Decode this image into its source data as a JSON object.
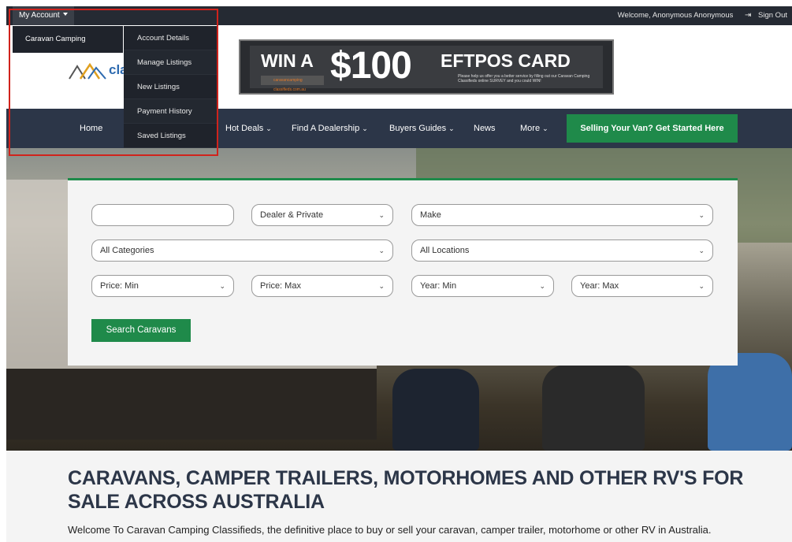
{
  "topbar": {
    "my_account_label": "My Account",
    "welcome_text": "Welcome, Anonymous Anonymous",
    "sign_out_label": "Sign Out"
  },
  "dropdown": {
    "site_label": "Caravan Camping Classifieds",
    "items": [
      {
        "label": "Account Details"
      },
      {
        "label": "Manage Listings"
      },
      {
        "label": "New Listings"
      },
      {
        "label": "Payment History"
      },
      {
        "label": "Saved Listings"
      }
    ]
  },
  "logo": {
    "partial_text": "cla"
  },
  "banner": {
    "win": "WIN A",
    "amount": "$100",
    "card": "EFTPOS CARD",
    "small": "Please help us offer you a better service by filling out our Caravan Camping Classifieds online SURVEY and you could WIN!",
    "brand": "caravancamping classifieds.com.au"
  },
  "nav": {
    "home": "Home",
    "hot_deals": "Hot Deals",
    "find_dealership": "Find A Dealership",
    "buyers_guides": "Buyers Guides",
    "news": "News",
    "more": "More",
    "cta": "Selling Your Van? Get Started Here"
  },
  "search": {
    "keyword_value": "",
    "seller_type": "Dealer & Private",
    "make": "Make",
    "categories": "All Categories",
    "locations": "All Locations",
    "price_min": "Price: Min",
    "price_max": "Price: Max",
    "year_min": "Year: Min",
    "year_max": "Year: Max",
    "button": "Search Caravans"
  },
  "content": {
    "heading": "CARAVANS, CAMPER TRAILERS, MOTORHOMES AND OTHER RV'S FOR SALE ACROSS AUSTRALIA",
    "intro": "Welcome To Caravan Camping Classifieds, the definitive place to buy or sell your caravan, camper trailer, motorhome or other RV in Australia."
  },
  "colors": {
    "topbar": "#252a33",
    "nav": "#2c3648",
    "accent_green": "#1f8a4a",
    "highlight_red": "#d0231c"
  }
}
